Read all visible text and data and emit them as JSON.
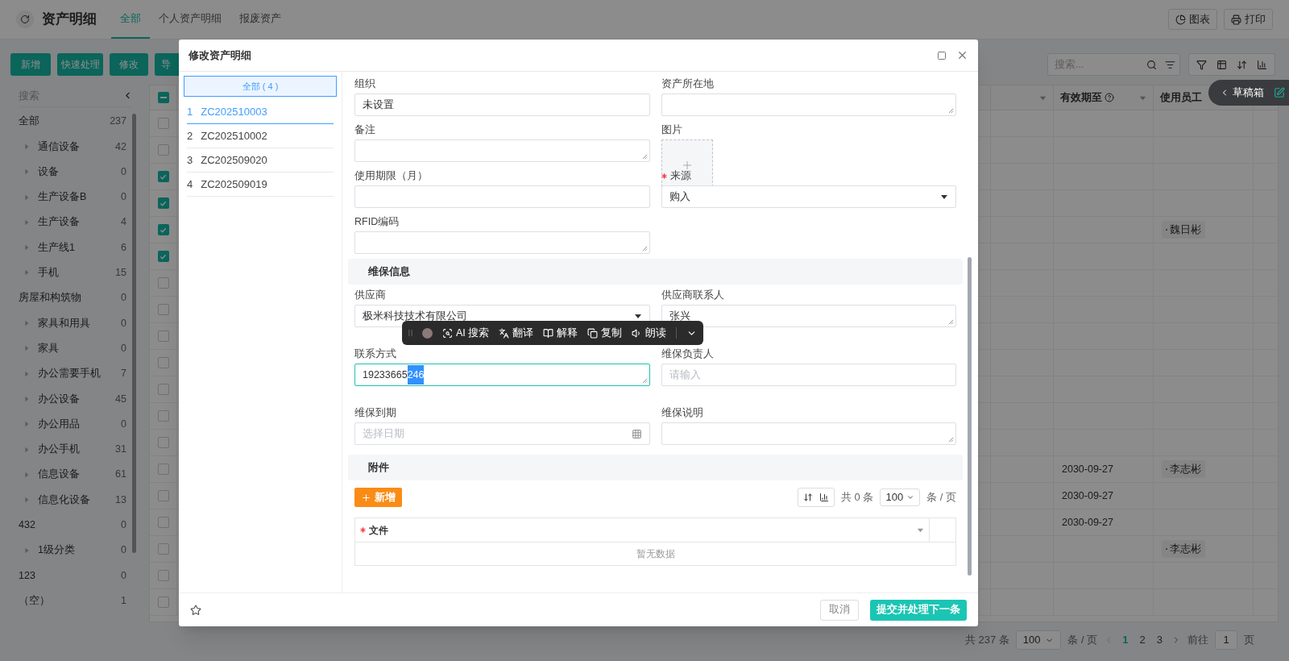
{
  "page": {
    "title": "资产明细",
    "tabs": [
      {
        "label": "全部",
        "selected": true
      },
      {
        "label": "个人资产明细",
        "selected": false
      },
      {
        "label": "报废资产",
        "selected": false
      }
    ],
    "header_buttons": [
      {
        "kind": "chart",
        "label": "图表"
      },
      {
        "kind": "print",
        "label": "打印"
      }
    ]
  },
  "toolbar": {
    "buttons": [
      "新增",
      "快速处理",
      "修改",
      "导"
    ],
    "search_placeholder": "搜索..."
  },
  "sidebar": {
    "search_placeholder": "搜索",
    "tree": [
      {
        "label": "全部",
        "count": "237",
        "children": [
          {
            "label": "通信设备",
            "count": "42",
            "expanded": false
          },
          {
            "label": "设备",
            "count": "0",
            "expanded": false
          },
          {
            "label": "生产设备B",
            "count": "0",
            "expanded": false
          },
          {
            "label": "生产设备",
            "count": "4",
            "expanded": false
          },
          {
            "label": "生产线1",
            "count": "6",
            "expanded": false
          },
          {
            "label": "手机",
            "count": "15",
            "expanded": false
          }
        ]
      },
      {
        "label": "房屋和构筑物",
        "count": "0",
        "children": [
          {
            "label": "家具和用具",
            "count": "0",
            "expanded": false
          },
          {
            "label": "家具",
            "count": "0",
            "expanded": false
          },
          {
            "label": "办公需要手机",
            "count": "7",
            "expanded": false
          },
          {
            "label": "办公设备",
            "count": "45",
            "expanded": false
          },
          {
            "label": "办公用品",
            "count": "0",
            "expanded": false
          },
          {
            "label": "办公手机",
            "count": "31",
            "expanded": false
          },
          {
            "label": "信息设备",
            "count": "61",
            "expanded": false
          },
          {
            "label": "信息化设备",
            "count": "13",
            "expanded": false
          }
        ]
      },
      {
        "label": "432",
        "count": "0",
        "children": [
          {
            "label": "1级分类",
            "count": "0",
            "expanded": false
          }
        ]
      },
      {
        "label": "123",
        "count": "0"
      },
      {
        "label": "（空）",
        "count": "1"
      }
    ]
  },
  "table": {
    "header_indeterminate": true,
    "columns": [
      {
        "label": "有效期至",
        "help_icon": true
      },
      {
        "label": "使用员工",
        "help_icon": false
      }
    ],
    "rows": [
      {
        "checked": false
      },
      {
        "checked": false
      },
      {
        "checked": true
      },
      {
        "checked": true
      },
      {
        "checked": true,
        "employee": "魏日彬"
      },
      {
        "checked": true
      },
      {
        "checked": false
      },
      {
        "checked": false
      },
      {
        "checked": false
      },
      {
        "checked": false
      },
      {
        "checked": false
      },
      {
        "checked": false
      },
      {
        "checked": false
      },
      {
        "checked": false,
        "valid_until": "2030-09-27",
        "employee": "李志彬"
      },
      {
        "checked": false,
        "valid_until": "2030-09-27"
      },
      {
        "checked": false,
        "valid_until": "2030-09-27"
      },
      {
        "checked": false,
        "employee": "李志彬"
      },
      {
        "checked": false
      },
      {
        "checked": false
      }
    ]
  },
  "pagination": {
    "total": "共 237 条",
    "page_size": "100",
    "per_page": "条 / 页",
    "pages": [
      {
        "label": "1",
        "selected": true
      },
      {
        "label": "2",
        "selected": false
      },
      {
        "label": "3",
        "selected": false
      }
    ],
    "goto_label": "前往",
    "goto_value": "1",
    "page_suffix": "页"
  },
  "draft_box": {
    "label": "草稿箱"
  },
  "modal": {
    "title": "修改资产明细",
    "records": {
      "all_label": "全部 ( 4 )",
      "items": [
        {
          "index": "1",
          "code": "ZC202510003",
          "selected": true
        },
        {
          "index": "2",
          "code": "ZC202510002",
          "selected": false
        },
        {
          "index": "3",
          "code": "ZC202509020",
          "selected": false
        },
        {
          "index": "4",
          "code": "ZC202509019",
          "selected": false
        }
      ]
    },
    "sections": [
      {
        "fields": [
          {
            "label": "组织",
            "kind": "input",
            "required": false,
            "value": "未设置"
          },
          {
            "label": "资产所在地",
            "kind": "textarea",
            "required": false
          },
          {
            "label": "备注",
            "kind": "textarea",
            "required": false
          },
          {
            "label": "图片",
            "kind": "image",
            "required": false
          },
          {
            "label": "使用期限（月）",
            "kind": "input",
            "required": false
          },
          {
            "label": "来源",
            "kind": "select",
            "required": true,
            "value": "购入"
          },
          {
            "label": "RFID编码",
            "kind": "textarea",
            "required": false
          }
        ]
      },
      {
        "title": "维保信息",
        "fields": [
          {
            "label": "供应商",
            "kind": "select",
            "required": false,
            "value": "极米科技技术有限公司"
          },
          {
            "label": "供应商联系人",
            "kind": "textarea",
            "required": false,
            "value": "张兴"
          },
          {
            "label": "联系方式",
            "kind": "textarea",
            "required": false,
            "focused": true,
            "value_parts": [
              {
                "text": "19233665",
                "selected": false
              },
              {
                "text": "246",
                "selected": true
              }
            ]
          },
          {
            "label": "维保负责人",
            "kind": "input",
            "required": false,
            "placeholder": "请输入"
          },
          {
            "label": "维保到期",
            "kind": "date",
            "required": false,
            "placeholder": "选择日期"
          },
          {
            "label": "维保说明",
            "kind": "textarea",
            "required": false
          }
        ]
      }
    ],
    "attachments": {
      "title": "附件",
      "add_button": "新增",
      "total": "共 0 条",
      "page_size": "100",
      "per_page": "条 / 页",
      "columns": [
        {
          "label": "文件",
          "required": true
        }
      ],
      "empty_text": "暂无数据"
    },
    "text_toolbar": {
      "items": [
        {
          "kind": "ai-search",
          "label": "AI 搜索"
        },
        {
          "kind": "translate",
          "label": "翻译"
        },
        {
          "kind": "explain",
          "label": "解释"
        },
        {
          "kind": "copy",
          "label": "复制"
        },
        {
          "kind": "read",
          "label": "朗读"
        }
      ]
    },
    "footer": {
      "cancel": "取消",
      "submit": "提交并处理下一条"
    }
  }
}
